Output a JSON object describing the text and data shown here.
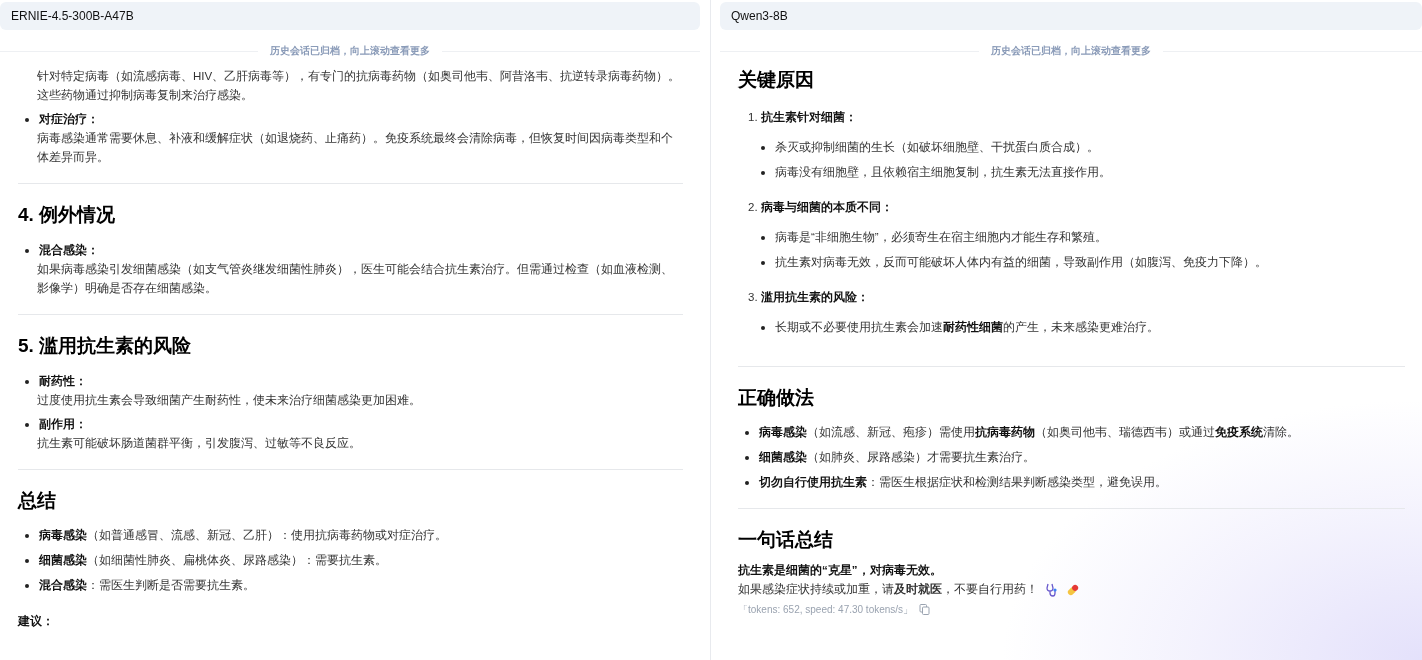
{
  "panels": [
    {
      "model": "ERNIE-4.5-300B-A47B",
      "archive_note": "历史会话已归档，向上滚动查看更多",
      "blocks": [
        {
          "kind": "bullets",
          "items": [
            {
              "text": "针对特定病毒（如流感病毒、HIV、乙肝病毒等），有专门的抗病毒药物（如奥司他韦、阿昔洛韦、抗逆转录病毒药物）。这些药物通过抑制病毒复制来治疗感染。"
            },
            {
              "label": "对症治疗：",
              "text": "病毒感染通常需要休息、补液和缓解症状（如退烧药、止痛药）。免疫系统最终会清除病毒，但恢复时间因病毒类型和个体差异而异。"
            }
          ]
        },
        {
          "kind": "rule"
        },
        {
          "kind": "heading",
          "text": "4. 例外情况"
        },
        {
          "kind": "bullets",
          "items": [
            {
              "label": "混合感染：",
              "text": "如果病毒感染引发细菌感染（如支气管炎继发细菌性肺炎），医生可能会结合抗生素治疗。但需通过检查（如血液检测、影像学）明确是否存在细菌感染。"
            }
          ]
        },
        {
          "kind": "rule"
        },
        {
          "kind": "heading",
          "text": "5. 滥用抗生素的风险"
        },
        {
          "kind": "bullets",
          "items": [
            {
              "label": "耐药性：",
              "text": "过度使用抗生素会导致细菌产生耐药性，使未来治疗细菌感染更加困难。"
            },
            {
              "label": "副作用：",
              "text": "抗生素可能破坏肠道菌群平衡，引发腹泻、过敏等不良反应。"
            }
          ]
        },
        {
          "kind": "rule"
        },
        {
          "kind": "heading",
          "text": "总结"
        },
        {
          "kind": "inline_bullets",
          "items": [
            "**病毒感染**（如普通感冒、流感、新冠、乙肝）：使用抗病毒药物或对症治疗。",
            "**细菌感染**（如细菌性肺炎、扁桃体炎、尿路感染）：需要抗生素。",
            "**混合感染**：需医生判断是否需要抗生素。"
          ]
        },
        {
          "kind": "paragraph",
          "bold": true,
          "text": "建议："
        }
      ]
    },
    {
      "model": "Qwen3-8B",
      "archive_note": "历史会话已归档，向上滚动查看更多",
      "blocks": [
        {
          "kind": "heading",
          "text": "关键原因"
        },
        {
          "kind": "numbered",
          "number": "1.",
          "title": "抗生素针对细菌：",
          "items": [
            "杀灭或抑制细菌的生长（如破坏细胞壁、干扰蛋白质合成）。",
            "病毒没有细胞壁，且依赖宿主细胞复制，抗生素无法直接作用。"
          ]
        },
        {
          "kind": "numbered",
          "number": "2.",
          "title": "病毒与细菌的本质不同：",
          "items": [
            "病毒是“非细胞生物”，必须寄生在宿主细胞内才能生存和繁殖。",
            "抗生素对病毒无效，反而可能破坏人体内有益的细菌，导致副作用（如腹泻、免疫力下降）。"
          ]
        },
        {
          "kind": "numbered",
          "number": "3.",
          "title": "滥用抗生素的风险：",
          "items": [
            "长期或不必要使用抗生素会加速**耐药性细菌**的产生，未来感染更难治疗。"
          ]
        },
        {
          "kind": "rule"
        },
        {
          "kind": "heading",
          "text": "正确做法"
        },
        {
          "kind": "inline_bullets",
          "items": [
            "**病毒感染**（如流感、新冠、疱疹）需使用**抗病毒药物**（如奥司他韦、瑞德西韦）或通过**免疫系统**清除。",
            "**细菌感染**（如肺炎、尿路感染）才需要抗生素治疗。",
            "**切勿自行使用抗生素**：需医生根据症状和检测结果判断感染类型，避免误用。"
          ]
        },
        {
          "kind": "rule"
        },
        {
          "kind": "heading",
          "text": "一句话总结"
        },
        {
          "kind": "paragraph",
          "bold": true,
          "text": "抗生素是细菌的“克星”，对病毒无效。"
        },
        {
          "kind": "closing_line",
          "text": "如果感染症状持续或加重，请**及时就医**，不要自行用药！"
        },
        {
          "kind": "stats",
          "text": "「tokens: 652, speed: 47.30 tokens/s」"
        }
      ]
    }
  ]
}
